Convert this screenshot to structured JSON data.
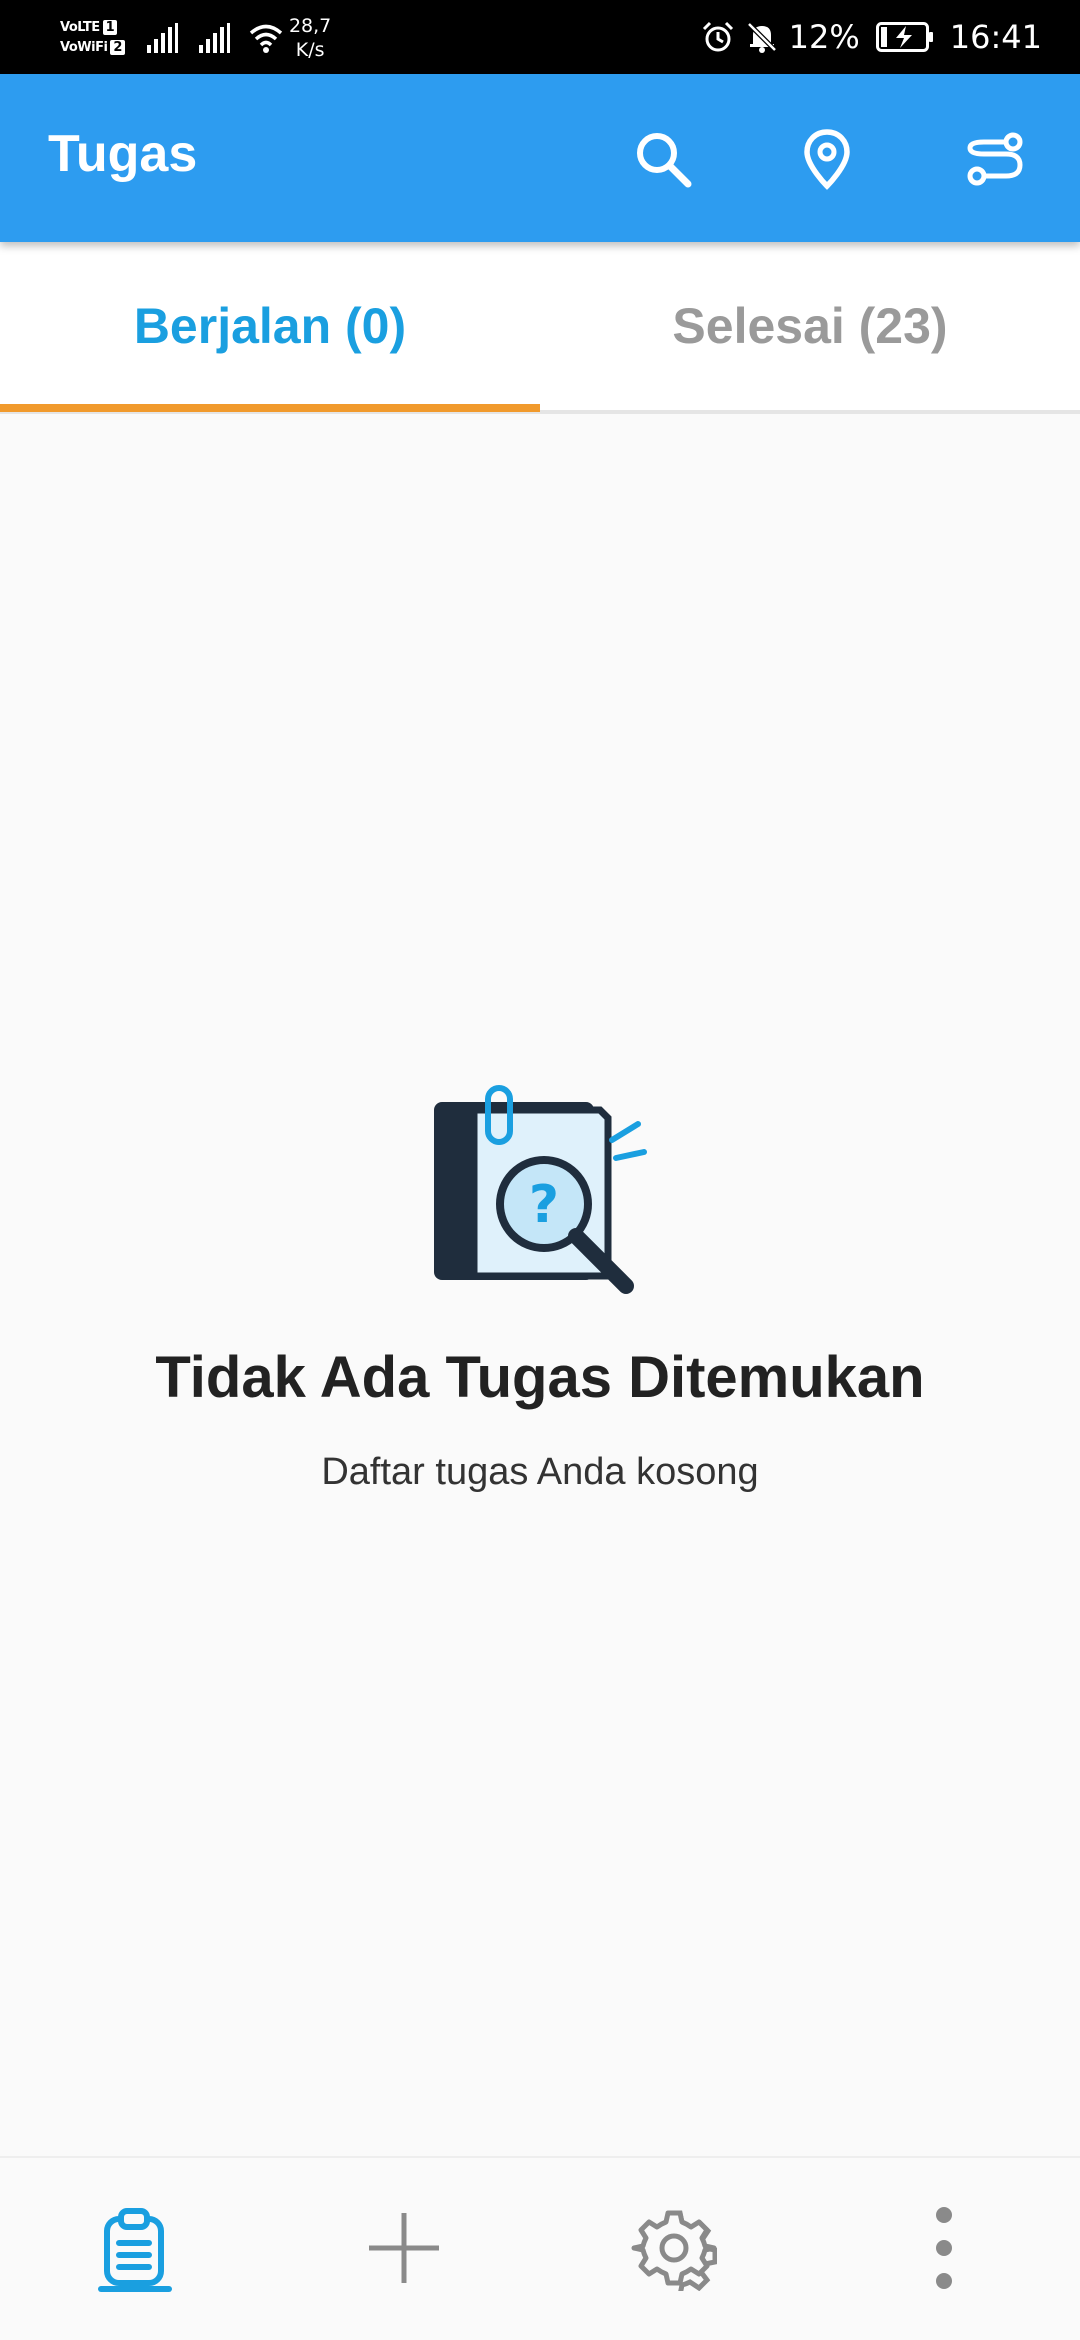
{
  "status_bar": {
    "sim1_label": "VoLTE",
    "sim1_num": "1",
    "sim2_label": "VoWiFi",
    "sim2_num": "2",
    "speed_value": "28,7",
    "speed_unit": "K/s",
    "battery_percent": "12%",
    "time": "16:41",
    "icons": [
      "signal-icon",
      "signal-icon",
      "wifi-icon",
      "alarm-icon",
      "bell-off-icon",
      "battery-charging-icon"
    ]
  },
  "app_bar": {
    "title": "Tugas",
    "actions": [
      "search-icon",
      "location-pin-icon",
      "route-icon"
    ],
    "background": "#2d9cf0"
  },
  "tabs": [
    {
      "label": "Berjalan (0)",
      "active": true
    },
    {
      "label": "Selesai (23)",
      "active": false
    }
  ],
  "colors": {
    "active_tab_text": "#1a9fe0",
    "inactive_tab_text": "#9a9a9a",
    "tab_indicator": "#f19a2c"
  },
  "empty_state": {
    "illustration": "document-search-icon",
    "title": "Tidak Ada Tugas Ditemukan",
    "subtitle": "Daftar tugas Anda kosong"
  },
  "bottom_nav": {
    "items": [
      "clipboard-icon",
      "plus-icon",
      "gear-icon",
      "more-vertical-icon"
    ],
    "selected_index": 0
  }
}
